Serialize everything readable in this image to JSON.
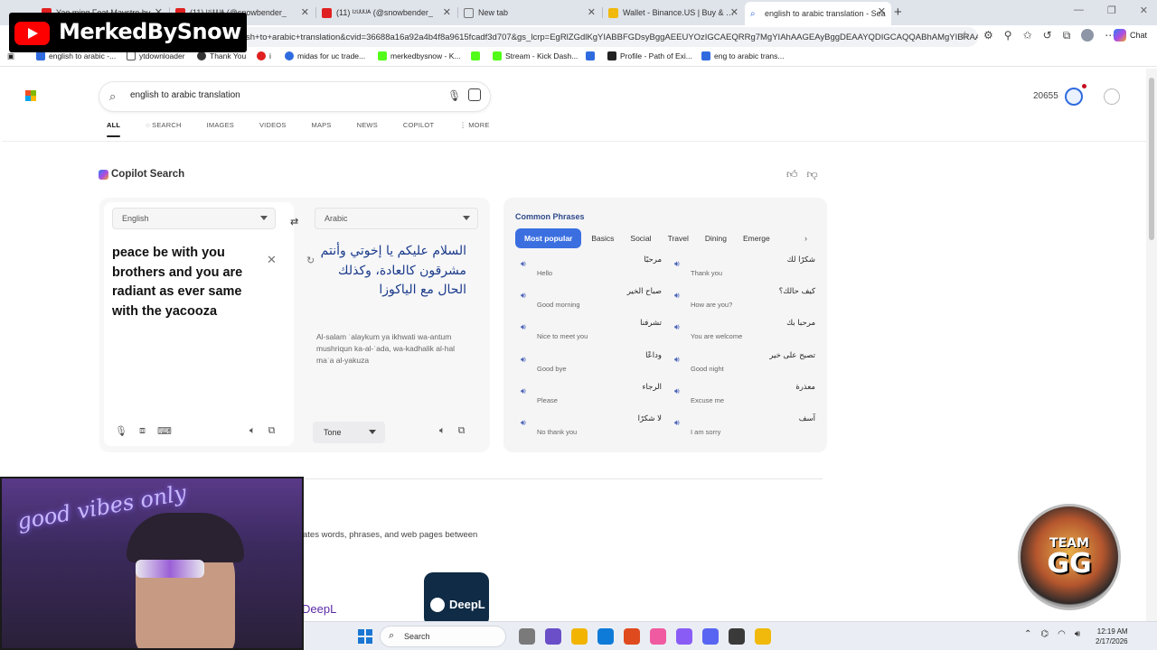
{
  "browser": {
    "tabs": [
      {
        "label": "Yao ming Feat Maystro by",
        "color": "#e02020"
      },
      {
        "label": "(11) ᴵᶻᵁᵁᵁᴬ (@snowbender_",
        "color": "#e02020"
      },
      {
        "label": "(11) ᴵᶻᵁᵁᵁᴬ (@snowbender_",
        "color": "#e02020"
      },
      {
        "label": "New tab",
        "color": "#7a7a7a"
      },
      {
        "label": "Wallet - Binance.US | Buy & Sell C",
        "color": "#f0b90b"
      },
      {
        "label": "english to arabic translation - Sea",
        "color": "#2f6bde"
      }
    ],
    "new_tab": "+",
    "url": "sh+to+arabic+translation&cvid=36688a16a92a4b4f8a9615fcadf3d707&gs_lcrp=EgRlZGdlKgYIABBFGDsyBggAEEUYOzIGCAEQRRg7MgYIAhAAGEAyBggDEAAYQDIGCAQQABhAMgYIBRAAG...",
    "chat_label": "Chat",
    "bookmarks": [
      {
        "label": "english to arabic -...",
        "color": "#2f6bde"
      },
      {
        "label": "ytdownloader",
        "color": "#555555"
      },
      {
        "label": "Thank You",
        "color": "#333333"
      },
      {
        "label": "i",
        "color": "#e02020"
      },
      {
        "label": "midas for uc trade...",
        "color": "#2f6bde"
      },
      {
        "label": "merkedbysnow - K...",
        "color": "#53fc18"
      },
      {
        "label": "",
        "color": "#53fc18"
      },
      {
        "label": "Stream - Kick Dash...",
        "color": "#53fc18"
      },
      {
        "label": "",
        "color": "#2f6bde"
      },
      {
        "label": "Profile - Path of Exi...",
        "color": "#222222"
      },
      {
        "label": "eng to arabic trans...",
        "color": "#2f6bde"
      }
    ]
  },
  "search": {
    "query": "english to arabic translation",
    "points": "20655",
    "nav": [
      "ALL",
      "SEARCH",
      "IMAGES",
      "VIDEOS",
      "MAPS",
      "NEWS",
      "COPILOT",
      "MORE"
    ]
  },
  "copilot": {
    "title": "Copilot Search"
  },
  "translator": {
    "source_lang": "English",
    "target_lang": "Arabic",
    "source_text": "peace be with you brothers and you are radiant as ever same with the yacooza",
    "target_text": "السلام عليكم يا إخوتي وأنتم مشرقون كالعادة، وكذلك الحال مع الياكوزا",
    "transliteration": "Al-salam ʿalaykum ya ikhwati wa-antum mushriqun ka-al-ʿada, wa-kadhalik al-hal maʿa al-yakuza",
    "tone": "Tone"
  },
  "phrases": {
    "title": "Common Phrases",
    "categories": [
      "Most popular",
      "Basics",
      "Social",
      "Travel",
      "Dining",
      "Emerge"
    ],
    "items": [
      {
        "ar": "مرحبًا",
        "en": "Hello"
      },
      {
        "ar": "شكرًا لك",
        "en": "Thank you"
      },
      {
        "ar": "صباح الخير",
        "en": "Good morning"
      },
      {
        "ar": "كيف حالك؟",
        "en": "How are you?"
      },
      {
        "ar": "تشرفنا",
        "en": "Nice to meet you"
      },
      {
        "ar": "مرحبا بك",
        "en": "You are welcome"
      },
      {
        "ar": "وداعًا",
        "en": "Good bye"
      },
      {
        "ar": "تصبح على خير",
        "en": "Good night"
      },
      {
        "ar": "الرجاء",
        "en": "Please"
      },
      {
        "ar": "معذرة",
        "en": "Excuse me"
      },
      {
        "ar": "لا شكرًا",
        "en": "No thank you"
      },
      {
        "ar": "آسف",
        "en": "I am sorry"
      }
    ]
  },
  "results": {
    "snippet": "ates words, phrases, and web pages between",
    "deepl_tile": "DeepL",
    "deepl_link": "DeepL"
  },
  "overlay": {
    "channel_name": "MerkedBySnow",
    "neon_sign": "good vibes only",
    "badge_top": "TEAM",
    "badge_main": "GG"
  },
  "taskbar": {
    "search_label": "Search",
    "time": "12:19 AM",
    "date": "2/17/2026",
    "app_colors": [
      "#7a7a7a",
      "#6a4fc8",
      "#f2b400",
      "#0f7bd8",
      "#e04a1f",
      "#f05aa0",
      "#8a5cf6",
      "#5865f2",
      "#3a3a3a",
      "#f0b90b"
    ]
  }
}
